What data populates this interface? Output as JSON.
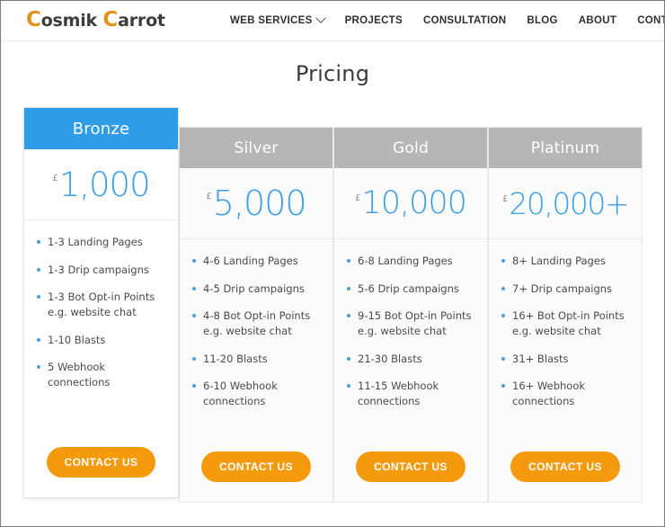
{
  "header": {
    "logo": {
      "part1_cap": "C",
      "part1_rest": "osmik ",
      "part2_cap": "C",
      "part2_rest": "arrot",
      "full_text": "Cosmik Carrot"
    },
    "nav": [
      {
        "label": "WEB SERVICES",
        "has_dropdown": true
      },
      {
        "label": "PROJECTS",
        "has_dropdown": false
      },
      {
        "label": "CONSULTATION",
        "has_dropdown": false
      },
      {
        "label": "BLOG",
        "has_dropdown": false
      },
      {
        "label": "ABOUT",
        "has_dropdown": false
      },
      {
        "label": "CONTACT",
        "has_dropdown": false
      }
    ]
  },
  "main": {
    "title": "Pricing",
    "cta_label": "CONTACT US",
    "currency_symbol": "£",
    "colors": {
      "featured_header": "#2f9ce8",
      "plain_header": "#b6b6b6",
      "price_text": "#3d9fe6",
      "cta_background": "#f59a0d",
      "bullet": "#4a9fd8",
      "logo_accent": "#e3931c"
    },
    "plans": [
      {
        "name": "Bronze",
        "featured": true,
        "price": "1,000",
        "features": [
          "1-3 Landing Pages",
          "1-3 Drip campaigns",
          "1-3 Bot Opt-in Points e.g. website chat",
          "1-10 Blasts",
          "5 Webhook connections"
        ]
      },
      {
        "name": "Silver",
        "featured": false,
        "price": "5,000",
        "features": [
          "4-6 Landing Pages",
          "4-5 Drip campaigns",
          "4-8 Bot Opt-in Points e.g. website chat",
          "11-20 Blasts",
          "6-10 Webhook connections"
        ]
      },
      {
        "name": "Gold",
        "featured": false,
        "price": "10,000",
        "features": [
          "6-8 Landing Pages",
          "5-6 Drip campaigns",
          "9-15 Bot Opt-in Points e.g. website chat",
          "21-30 Blasts",
          "11-15 Webhook connections"
        ]
      },
      {
        "name": "Platinum",
        "featured": false,
        "price": "20,000+",
        "features": [
          "8+ Landing Pages",
          "7+ Drip campaigns",
          "16+ Bot Opt-in Points e.g. website chat",
          "31+ Blasts",
          "16+ Webhook connections"
        ]
      }
    ]
  }
}
